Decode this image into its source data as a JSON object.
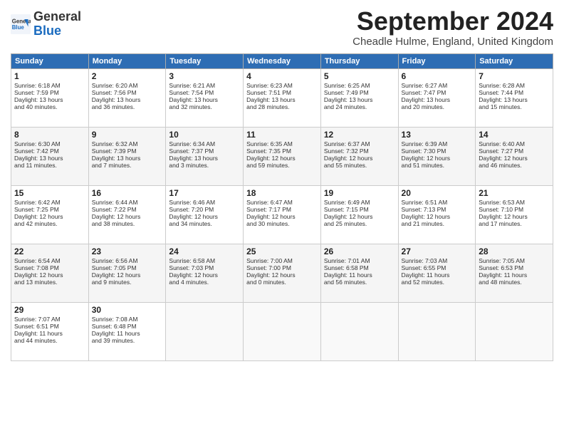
{
  "header": {
    "logo_line1": "General",
    "logo_line2": "Blue",
    "month_title": "September 2024",
    "subtitle": "Cheadle Hulme, England, United Kingdom"
  },
  "days_of_week": [
    "Sunday",
    "Monday",
    "Tuesday",
    "Wednesday",
    "Thursday",
    "Friday",
    "Saturday"
  ],
  "weeks": [
    [
      {
        "day": "1",
        "lines": [
          "Sunrise: 6:18 AM",
          "Sunset: 7:59 PM",
          "Daylight: 13 hours",
          "and 40 minutes."
        ]
      },
      {
        "day": "2",
        "lines": [
          "Sunrise: 6:20 AM",
          "Sunset: 7:56 PM",
          "Daylight: 13 hours",
          "and 36 minutes."
        ]
      },
      {
        "day": "3",
        "lines": [
          "Sunrise: 6:21 AM",
          "Sunset: 7:54 PM",
          "Daylight: 13 hours",
          "and 32 minutes."
        ]
      },
      {
        "day": "4",
        "lines": [
          "Sunrise: 6:23 AM",
          "Sunset: 7:51 PM",
          "Daylight: 13 hours",
          "and 28 minutes."
        ]
      },
      {
        "day": "5",
        "lines": [
          "Sunrise: 6:25 AM",
          "Sunset: 7:49 PM",
          "Daylight: 13 hours",
          "and 24 minutes."
        ]
      },
      {
        "day": "6",
        "lines": [
          "Sunrise: 6:27 AM",
          "Sunset: 7:47 PM",
          "Daylight: 13 hours",
          "and 20 minutes."
        ]
      },
      {
        "day": "7",
        "lines": [
          "Sunrise: 6:28 AM",
          "Sunset: 7:44 PM",
          "Daylight: 13 hours",
          "and 15 minutes."
        ]
      }
    ],
    [
      {
        "day": "8",
        "lines": [
          "Sunrise: 6:30 AM",
          "Sunset: 7:42 PM",
          "Daylight: 13 hours",
          "and 11 minutes."
        ]
      },
      {
        "day": "9",
        "lines": [
          "Sunrise: 6:32 AM",
          "Sunset: 7:39 PM",
          "Daylight: 13 hours",
          "and 7 minutes."
        ]
      },
      {
        "day": "10",
        "lines": [
          "Sunrise: 6:34 AM",
          "Sunset: 7:37 PM",
          "Daylight: 13 hours",
          "and 3 minutes."
        ]
      },
      {
        "day": "11",
        "lines": [
          "Sunrise: 6:35 AM",
          "Sunset: 7:35 PM",
          "Daylight: 12 hours",
          "and 59 minutes."
        ]
      },
      {
        "day": "12",
        "lines": [
          "Sunrise: 6:37 AM",
          "Sunset: 7:32 PM",
          "Daylight: 12 hours",
          "and 55 minutes."
        ]
      },
      {
        "day": "13",
        "lines": [
          "Sunrise: 6:39 AM",
          "Sunset: 7:30 PM",
          "Daylight: 12 hours",
          "and 51 minutes."
        ]
      },
      {
        "day": "14",
        "lines": [
          "Sunrise: 6:40 AM",
          "Sunset: 7:27 PM",
          "Daylight: 12 hours",
          "and 46 minutes."
        ]
      }
    ],
    [
      {
        "day": "15",
        "lines": [
          "Sunrise: 6:42 AM",
          "Sunset: 7:25 PM",
          "Daylight: 12 hours",
          "and 42 minutes."
        ]
      },
      {
        "day": "16",
        "lines": [
          "Sunrise: 6:44 AM",
          "Sunset: 7:22 PM",
          "Daylight: 12 hours",
          "and 38 minutes."
        ]
      },
      {
        "day": "17",
        "lines": [
          "Sunrise: 6:46 AM",
          "Sunset: 7:20 PM",
          "Daylight: 12 hours",
          "and 34 minutes."
        ]
      },
      {
        "day": "18",
        "lines": [
          "Sunrise: 6:47 AM",
          "Sunset: 7:17 PM",
          "Daylight: 12 hours",
          "and 30 minutes."
        ]
      },
      {
        "day": "19",
        "lines": [
          "Sunrise: 6:49 AM",
          "Sunset: 7:15 PM",
          "Daylight: 12 hours",
          "and 25 minutes."
        ]
      },
      {
        "day": "20",
        "lines": [
          "Sunrise: 6:51 AM",
          "Sunset: 7:13 PM",
          "Daylight: 12 hours",
          "and 21 minutes."
        ]
      },
      {
        "day": "21",
        "lines": [
          "Sunrise: 6:53 AM",
          "Sunset: 7:10 PM",
          "Daylight: 12 hours",
          "and 17 minutes."
        ]
      }
    ],
    [
      {
        "day": "22",
        "lines": [
          "Sunrise: 6:54 AM",
          "Sunset: 7:08 PM",
          "Daylight: 12 hours",
          "and 13 minutes."
        ]
      },
      {
        "day": "23",
        "lines": [
          "Sunrise: 6:56 AM",
          "Sunset: 7:05 PM",
          "Daylight: 12 hours",
          "and 9 minutes."
        ]
      },
      {
        "day": "24",
        "lines": [
          "Sunrise: 6:58 AM",
          "Sunset: 7:03 PM",
          "Daylight: 12 hours",
          "and 4 minutes."
        ]
      },
      {
        "day": "25",
        "lines": [
          "Sunrise: 7:00 AM",
          "Sunset: 7:00 PM",
          "Daylight: 12 hours",
          "and 0 minutes."
        ]
      },
      {
        "day": "26",
        "lines": [
          "Sunrise: 7:01 AM",
          "Sunset: 6:58 PM",
          "Daylight: 11 hours",
          "and 56 minutes."
        ]
      },
      {
        "day": "27",
        "lines": [
          "Sunrise: 7:03 AM",
          "Sunset: 6:55 PM",
          "Daylight: 11 hours",
          "and 52 minutes."
        ]
      },
      {
        "day": "28",
        "lines": [
          "Sunrise: 7:05 AM",
          "Sunset: 6:53 PM",
          "Daylight: 11 hours",
          "and 48 minutes."
        ]
      }
    ],
    [
      {
        "day": "29",
        "lines": [
          "Sunrise: 7:07 AM",
          "Sunset: 6:51 PM",
          "Daylight: 11 hours",
          "and 44 minutes."
        ]
      },
      {
        "day": "30",
        "lines": [
          "Sunrise: 7:08 AM",
          "Sunset: 6:48 PM",
          "Daylight: 11 hours",
          "and 39 minutes."
        ]
      },
      {
        "day": "",
        "lines": []
      },
      {
        "day": "",
        "lines": []
      },
      {
        "day": "",
        "lines": []
      },
      {
        "day": "",
        "lines": []
      },
      {
        "day": "",
        "lines": []
      }
    ]
  ]
}
